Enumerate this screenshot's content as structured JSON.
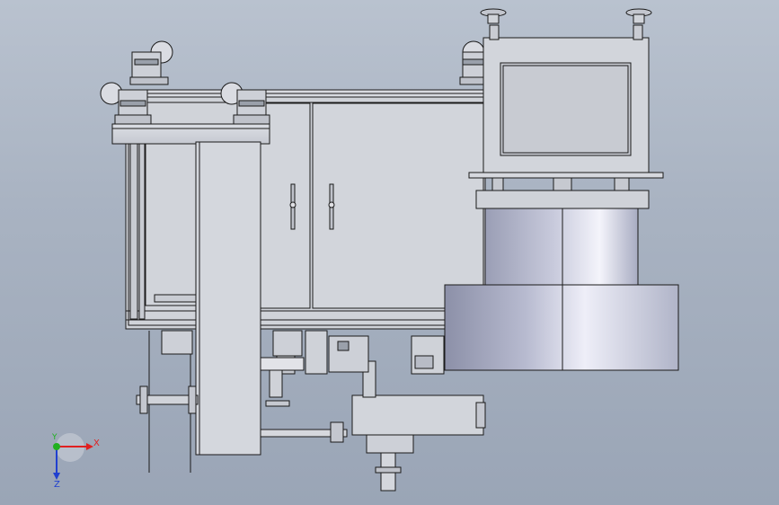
{
  "triad": {
    "x_label": "X",
    "y_label": "Y",
    "z_label": "Z",
    "x_color": "#e02020",
    "y_color": "#20b020",
    "z_color": "#2040d0"
  },
  "colors": {
    "background": "#a9b3c2",
    "part_light": "#d6d8de",
    "part_mid": "#c4c7cf",
    "line": "#1a1a1a",
    "cylinder_highlight": "#f2f2fa",
    "cylinder_shade": "#8a8ea6"
  }
}
